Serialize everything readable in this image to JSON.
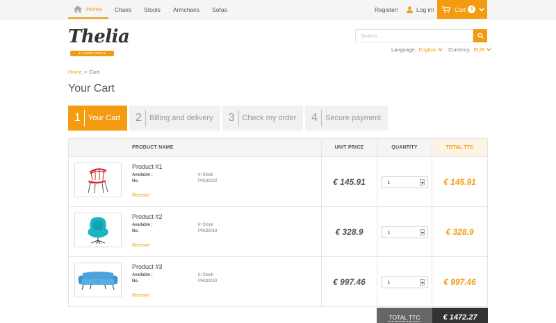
{
  "nav": {
    "items": [
      {
        "label": "Home",
        "active": true
      },
      {
        "label": "Chairs"
      },
      {
        "label": "Stools"
      },
      {
        "label": "Armchairs"
      },
      {
        "label": "Sofas"
      }
    ]
  },
  "account": {
    "register_label": "Register!",
    "login_label": "Log in!"
  },
  "cart_button": {
    "label": "Cart",
    "count": "3"
  },
  "logo": {
    "text": "Thelia",
    "ribbon": "★ SINCE 2006 ★"
  },
  "search": {
    "placeholder": "Search..."
  },
  "settings": {
    "language_label": "Language:",
    "language_value": "English",
    "currency_label": "Currency:",
    "currency_value": "EUR"
  },
  "breadcrumb": {
    "home": "Home",
    "separator": ">",
    "current": "Cart"
  },
  "page_title": "Your Cart",
  "steps": [
    {
      "num": "1",
      "label": "Your Cart",
      "active": true
    },
    {
      "num": "2",
      "label": "Billing and delivery"
    },
    {
      "num": "3",
      "label": "Check my order"
    },
    {
      "num": "4",
      "label": "Secure payment"
    }
  ],
  "table": {
    "headers": {
      "product_name": "PRODUCT NAME",
      "unit_price": "UNIT PRICE",
      "quantity": "QUANTITY",
      "total": "TOTAL TTC"
    },
    "rows": [
      {
        "name": "Product #1",
        "available_label": "Available :",
        "available_value": "In Stock",
        "no_label": "No.",
        "no_value": "PROD022",
        "remove": "Remove",
        "unit_price": "€ 145.91",
        "quantity": "1",
        "total": "€ 145.91",
        "image": "red-chair-icon"
      },
      {
        "name": "Product #2",
        "available_label": "Available :",
        "available_value": "In Stock",
        "no_label": "No.",
        "no_value": "PROD019",
        "remove": "Remove",
        "unit_price": "€ 328.9",
        "quantity": "1",
        "total": "€ 328.9",
        "image": "teal-egg-chair-icon"
      },
      {
        "name": "Product #3",
        "available_label": "Available :",
        "available_value": "In Stock",
        "no_label": "No.",
        "no_value": "PROD010",
        "remove": "Remove",
        "unit_price": "€ 997.46",
        "quantity": "1",
        "total": "€ 997.46",
        "image": "blue-sofa-icon"
      }
    ]
  },
  "summary": {
    "total_label": "TOTAL TTC",
    "total_value": "€ 1472.27"
  },
  "colors": {
    "accent": "#f39c12",
    "dark": "#333333"
  }
}
